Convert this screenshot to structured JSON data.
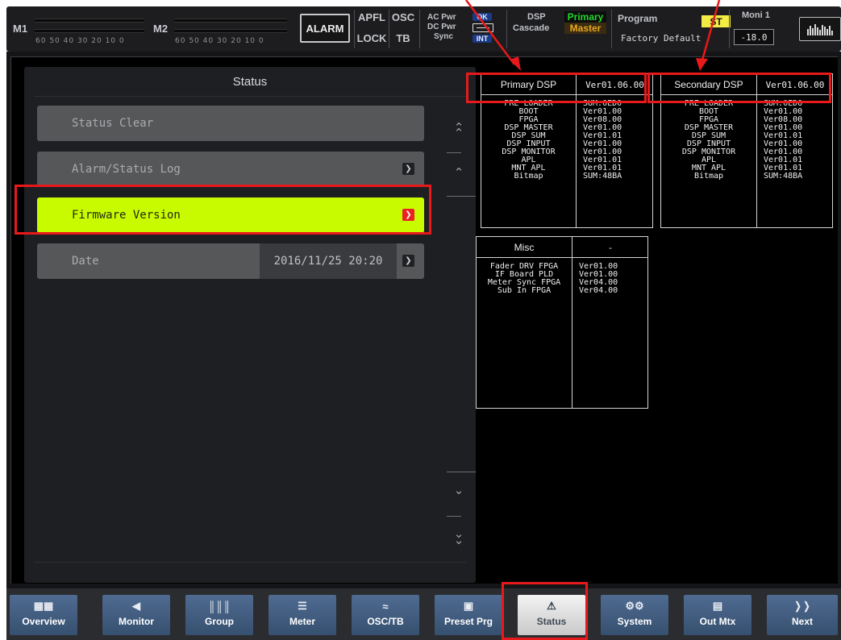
{
  "topbar": {
    "m1_label": "M1",
    "m2_label": "M2",
    "meter_scale": "60 50 40 30 20 10  0",
    "alarm": "ALARM",
    "apfl": "APFL",
    "osc": "OSC",
    "lock": "LOCK",
    "tb": "TB",
    "ac_pwr": "AC Pwr",
    "dc_pwr": "DC Pwr",
    "sync": "Sync",
    "ok": "OK",
    "int": "INT",
    "dsp": "DSP",
    "cascade": "Cascade",
    "primary": "Primary",
    "master": "Master",
    "program": "Program",
    "program_mode": "ST",
    "factory_default": "Factory Default",
    "moni": "Moni 1",
    "moni_value": "-18.0"
  },
  "status_panel": {
    "title": "Status",
    "items": [
      {
        "label": "Status Clear"
      },
      {
        "label": "Alarm/Status Log"
      },
      {
        "label": "Firmware Version",
        "active": true
      },
      {
        "label": "Date",
        "value": "2016/11/25 20:20"
      }
    ]
  },
  "primary_dsp": {
    "title": "Primary DSP",
    "version": "Ver01.06.00",
    "rows": [
      {
        "name": "PRE LOADER",
        "ver": "SUM:0ED0"
      },
      {
        "name": "BOOT",
        "ver": "Ver01.00"
      },
      {
        "name": "FPGA",
        "ver": "Ver08.00"
      },
      {
        "name": "DSP MASTER",
        "ver": "Ver01.00"
      },
      {
        "name": "DSP SUM",
        "ver": "Ver01.01"
      },
      {
        "name": "DSP INPUT",
        "ver": "Ver01.00"
      },
      {
        "name": "DSP MONITOR",
        "ver": "Ver01.00"
      },
      {
        "name": "APL",
        "ver": "Ver01.01"
      },
      {
        "name": "MNT APL",
        "ver": "Ver01.01"
      },
      {
        "name": "Bitmap",
        "ver": "SUM:48BA"
      }
    ]
  },
  "secondary_dsp": {
    "title": "Secondary DSP",
    "version": "Ver01.06.00",
    "rows": [
      {
        "name": "PRE LOADER",
        "ver": "SUM:0ED0"
      },
      {
        "name": "BOOT",
        "ver": "Ver01.00"
      },
      {
        "name": "FPGA",
        "ver": "Ver08.00"
      },
      {
        "name": "DSP MASTER",
        "ver": "Ver01.00"
      },
      {
        "name": "DSP SUM",
        "ver": "Ver01.01"
      },
      {
        "name": "DSP INPUT",
        "ver": "Ver01.00"
      },
      {
        "name": "DSP MONITOR",
        "ver": "Ver01.00"
      },
      {
        "name": "APL",
        "ver": "Ver01.01"
      },
      {
        "name": "MNT APL",
        "ver": "Ver01.01"
      },
      {
        "name": "Bitmap",
        "ver": "SUM:48BA"
      }
    ]
  },
  "misc": {
    "title": "Misc",
    "version": "-",
    "rows": [
      {
        "name": "Fader DRV FPGA",
        "ver": "Ver01.00"
      },
      {
        "name": "IF Board PLD",
        "ver": "Ver01.00"
      },
      {
        "name": "Meter Sync FPGA",
        "ver": "Ver04.00"
      },
      {
        "name": "Sub In FPGA",
        "ver": "Ver04.00"
      }
    ]
  },
  "nav": [
    {
      "label": "Overview",
      "icon": "grid-icon"
    },
    {
      "label": "Monitor",
      "icon": "speaker-icon"
    },
    {
      "label": "Group",
      "icon": "faders-icon"
    },
    {
      "label": "Meter",
      "icon": "meter-icon"
    },
    {
      "label": "OSC/TB",
      "icon": "wave-icon"
    },
    {
      "label": "Preset Prg",
      "icon": "preset-icon"
    },
    {
      "label": "Status",
      "icon": "warning-icon",
      "active": true
    },
    {
      "label": "System",
      "icon": "gears-icon"
    },
    {
      "label": "Out Mtx",
      "icon": "matrix-icon"
    },
    {
      "label": "Next",
      "icon": "double-chevron-right-icon"
    }
  ],
  "colors": {
    "accent_active": "#c8fb00",
    "annotation_red": "#e8191b",
    "nav_blue": "#4f6b91"
  }
}
